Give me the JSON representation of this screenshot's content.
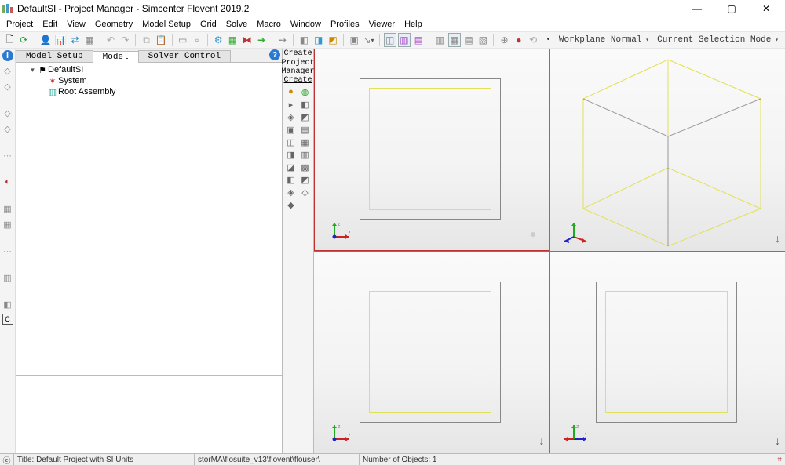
{
  "title": "DefaultSI - Project Manager - Simcenter Flovent 2019.2",
  "window_controls": {
    "min": "—",
    "max": "▢",
    "close": "✕"
  },
  "menus": [
    "Project",
    "Edit",
    "View",
    "Geometry",
    "Model Setup",
    "Grid",
    "Solve",
    "Macro",
    "Window",
    "Profiles",
    "Viewer",
    "Help"
  ],
  "toolbar_right": {
    "workplane": "Workplane Normal",
    "selection_mode": "Current Selection Mode"
  },
  "tabs": {
    "t1": "Model Setup",
    "t2": "Model",
    "t3": "Solver Control"
  },
  "tree": {
    "root": "DefaultSI",
    "n1": "System",
    "n2": "Root Assembly"
  },
  "create": {
    "hdr": "Create",
    "l1": "Project",
    "l2": "Manager",
    "l3": "Create"
  },
  "status": {
    "title_cell": "Title: Default Project with SI Units",
    "path_cell": "storMA\\flosuite_v13\\flovent\\flouser\\",
    "objects": "Number of Objects: 1"
  },
  "left_icons": [
    "i",
    "◇",
    "◇",
    "◇",
    "◇",
    "⋯",
    "◐",
    "▦",
    "▦",
    "⋯",
    "▥",
    "◧",
    "C"
  ],
  "axis_labels": {
    "x": "x",
    "y": "y",
    "z": "z"
  }
}
